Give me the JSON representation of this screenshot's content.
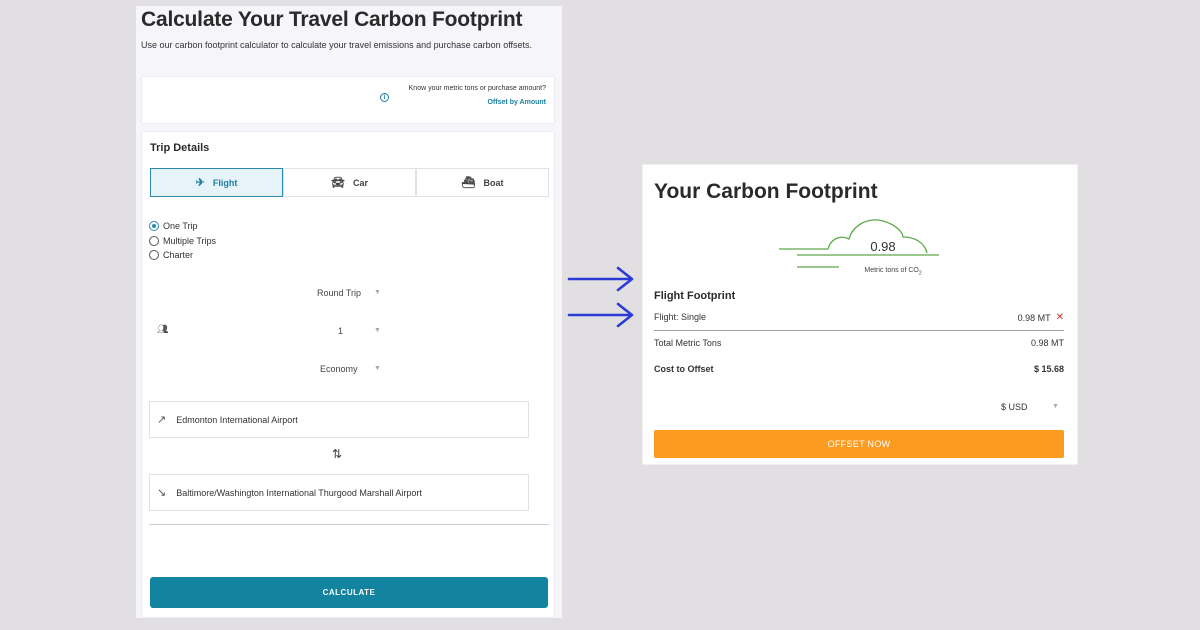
{
  "calculator": {
    "title": "Calculate Your Travel Carbon Footprint",
    "intro": "Use our carbon footprint calculator to calculate your travel emissions and purchase carbon offsets.",
    "amount_prompt": "Know your metric tons or purchase amount?",
    "amount_link": "Offset by Amount",
    "trip_details_heading": "Trip Details",
    "tabs": [
      {
        "label": "Flight",
        "icon": "airplane-icon",
        "active": true
      },
      {
        "label": "Car",
        "icon": "car-icon",
        "active": false
      },
      {
        "label": "Boat",
        "icon": "boat-icon",
        "active": false
      }
    ],
    "trip_types": [
      {
        "label": "One Trip",
        "selected": true
      },
      {
        "label": "Multiple Trips",
        "selected": false
      },
      {
        "label": "Charter",
        "selected": false
      }
    ],
    "journey_type": "Round Trip",
    "passengers": "1",
    "cabin_class": "Economy",
    "origin": "Edmonton International Airport",
    "destination": "Baltimore/Washington International Thurgood Marshall Airport",
    "calculate_label": "CALCULATE"
  },
  "result": {
    "title": "Your Carbon Footprint",
    "cloud_value": "0.98",
    "cloud_unit": "Metric tons of CO",
    "cloud_unit_sub": "2",
    "footprint_heading": "Flight Footprint",
    "line_item_label": "Flight: Single",
    "line_item_value": "0.98 MT",
    "total_label": "Total Metric Tons",
    "total_value": "0.98 MT",
    "cost_label": "Cost to Offset",
    "cost_value": "$ 15.68",
    "currency": "$ USD",
    "offset_label": "OFFSET NOW"
  },
  "colors": {
    "accent_teal": "#13849f",
    "offset_orange": "#fb9b1f",
    "arrow_blue": "#2b3bd6",
    "cloud_green": "#5ea84a"
  }
}
